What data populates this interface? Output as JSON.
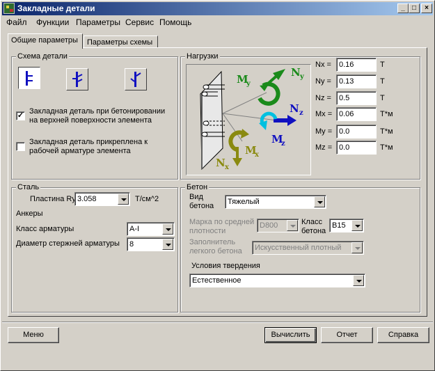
{
  "window": {
    "title": "Закладные детали"
  },
  "menu": [
    "Файл",
    "Функции",
    "Параметры",
    "Сервис",
    "Помощь"
  ],
  "tabs": [
    "Общие параметры",
    "Параметры схемы"
  ],
  "scheme": {
    "title": "Схема детали",
    "checkbox1_label": "Закладная деталь при бетонировании на верхней поверхности элемента",
    "checkbox1_checked": "✓",
    "checkbox2_label": "Закладная деталь прикреплена к рабочей арматуре элемента"
  },
  "loads": {
    "title": "Нагрузки",
    "rows": [
      {
        "label": "Nx =",
        "value": "0.16",
        "unit": "T"
      },
      {
        "label": "Ny =",
        "value": "0.13",
        "unit": "T"
      },
      {
        "label": "Nz =",
        "value": "0.5",
        "unit": "T"
      },
      {
        "label": "Mx =",
        "value": "0.06",
        "unit": "T*м"
      },
      {
        "label": "My =",
        "value": "0.0",
        "unit": "T*м"
      },
      {
        "label": "Mz =",
        "value": "0.0",
        "unit": "T*м"
      }
    ],
    "diagram_labels": {
      "my": "M",
      "my_sub": "y",
      "ny": "N",
      "ny_sub": "y",
      "nz": "N",
      "nz_sub": "z",
      "mz": "M",
      "mz_sub": "z",
      "mx": "M",
      "mx_sub": "x",
      "nx": "N",
      "nx_sub": "x"
    }
  },
  "steel": {
    "title": "Сталь",
    "plate_label": "Пластина Ry=",
    "plate_value": "3.058",
    "plate_unit": "Т/см^2",
    "anchors_label": "Анкеры",
    "rebar_class_label": "Класс арматуры",
    "rebar_class_value": "A-I",
    "rebar_diameter_label": "Диаметр стержней арматуры",
    "rebar_diameter_value": "8"
  },
  "concrete": {
    "title": "Бетон",
    "type_label": "Вид бетона",
    "type_value": "Тяжелый",
    "density_label": "Марка по средней плотности",
    "density_value": "D800",
    "class_label": "Класс бетона",
    "class_value": "B15",
    "filler_label": "Заполнитель легкого бетона",
    "filler_value": "Искусственный плотный",
    "curing_label": "Условия твердения",
    "curing_value": "Естественное"
  },
  "buttons": {
    "menu": "Меню",
    "calculate": "Вычислить",
    "report": "Отчет",
    "help": "Справка"
  },
  "colors": {
    "titlebar": "#0a246a",
    "moment_green": "#1a8a1a",
    "moment_olive": "#8a8a10",
    "force_blue": "#1010c0",
    "cyan": "#00c0e0"
  }
}
